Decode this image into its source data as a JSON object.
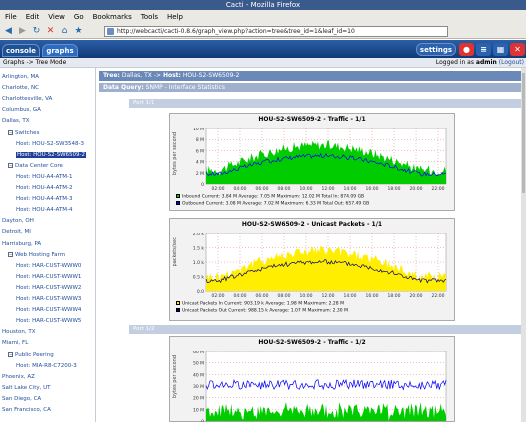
{
  "window": {
    "title": "Cacti - Mozilla Firefox"
  },
  "menu": [
    {
      "label": "File"
    },
    {
      "label": "Edit"
    },
    {
      "label": "View"
    },
    {
      "label": "Go"
    },
    {
      "label": "Bookmarks"
    },
    {
      "label": "Tools"
    },
    {
      "label": "Help"
    }
  ],
  "address": {
    "url": "http://webcacti/cacti-0.8.6/graph_view.php?action=tree&tree_id=1&leaf_id=10"
  },
  "tabs": {
    "console": "console",
    "graphs": "graphs",
    "settings": "settings"
  },
  "breadcrumb": {
    "text": "Graphs -> Tree Mode",
    "logged_prefix": "Logged in as ",
    "user": "admin",
    "logout": "(Logout)"
  },
  "sidebar": {
    "items": [
      {
        "label": "Arlington, MA",
        "level": 0
      },
      {
        "label": "Charlotte, NC",
        "level": 0
      },
      {
        "label": "Charlottesville, VA",
        "level": 0
      },
      {
        "label": "Columbus, GA",
        "level": 0
      },
      {
        "label": "Dallas, TX",
        "level": 0
      },
      {
        "label": "Switches",
        "level": 1,
        "icon": "folder"
      },
      {
        "label": "Host: HOU-S2-SW3548-3",
        "level": 2
      },
      {
        "label": "Host: HOU-S2-SW6509-2",
        "level": 2,
        "selected": true
      },
      {
        "label": "Data Center Core",
        "level": 1,
        "icon": "folder"
      },
      {
        "label": "Host: HOU-A4-ATM-1",
        "level": 2
      },
      {
        "label": "Host: HOU-A4-ATM-2",
        "level": 2
      },
      {
        "label": "Host: HOU-A4-ATM-3",
        "level": 2
      },
      {
        "label": "Host: HOU-A4-ATM-4",
        "level": 2
      },
      {
        "label": "Dayton, OH",
        "level": 0
      },
      {
        "label": "Detroit, MI",
        "level": 0
      },
      {
        "label": "Harrisburg, PA",
        "level": 0
      },
      {
        "label": "Web Hosting Farm",
        "level": 1,
        "icon": "folder"
      },
      {
        "label": "Host: HAR-CUST-WWW0",
        "level": 2
      },
      {
        "label": "Host: HAR-CUST-WWW1",
        "level": 2
      },
      {
        "label": "Host: HAR-CUST-WWW2",
        "level": 2
      },
      {
        "label": "Host: HAR-CUST-WWW3",
        "level": 2
      },
      {
        "label": "Host: HAR-CUST-WWW4",
        "level": 2
      },
      {
        "label": "Host: HAR-CUST-WWW5",
        "level": 2
      },
      {
        "label": "Houston, TX",
        "level": 0
      },
      {
        "label": "Miami, FL",
        "level": 0
      },
      {
        "label": "Public Peering",
        "level": 1,
        "icon": "folder"
      },
      {
        "label": "Host: MIA-R8-C7200-3",
        "level": 2
      },
      {
        "label": "Phoenix, AZ",
        "level": 0
      },
      {
        "label": "Salt Lake City, UT",
        "level": 0
      },
      {
        "label": "San Diego, CA",
        "level": 0
      },
      {
        "label": "San Francisco, CA",
        "level": 0
      }
    ]
  },
  "main": {
    "tree_header": {
      "tree_label": "Tree:",
      "tree": "Dallas, TX",
      "sep": "->",
      "host_label": "Host:",
      "host": "HOU-S2-SW6509-2"
    },
    "data_query": {
      "label": "Data Query:",
      "value": "SNMP - Interface Statistics"
    },
    "ports": [
      {
        "label": "Port 1/1"
      },
      {
        "label": "Port 1/2"
      }
    ],
    "graphs": [
      {
        "title": "HOU-S2-SW6509-2 - Traffic - 1/1",
        "ylabel": "bytes per second",
        "yticks": [
          "10 M",
          "8 M",
          "6 M",
          "4 M",
          "2 M",
          "0"
        ],
        "xticks": [
          "02:00",
          "04:00",
          "06:00",
          "08:00",
          "10:00",
          "12:00",
          "14:00",
          "16:00",
          "18:00",
          "20:00",
          "22:00"
        ],
        "legend": [
          "Inbound   Current:   3.84 M   Average:   7.05 M   Maximum:  12.02 M   Total In:  874.09 GB",
          "Outbound  Current:   3.08 M   Average:   7.02 M   Maximum:   6.33 M   Total Out: 657.49 GB"
        ],
        "colors": [
          "#00cc00",
          "#0000ff"
        ]
      },
      {
        "title": "HOU-S2-SW6509-2 - Unicast Packets - 1/1",
        "ylabel": "packets/sec",
        "yticks": [
          "2.0 k",
          "1.5 k",
          "1.0 k",
          "0.5 k",
          "0.0"
        ],
        "xticks": [
          "02:00",
          "04:00",
          "06:00",
          "08:00",
          "10:00",
          "12:00",
          "14:00",
          "16:00",
          "18:00",
          "20:00",
          "22:00"
        ],
        "legend": [
          "Unicast Packets In   Current:  903.19 k   Average:   1.98 M   Maximum:   2.28 M",
          "Unicast Packets Out  Current:  988.15 k   Average:   1.07 M   Maximum:   2.30 M"
        ],
        "colors": [
          "#ffee00",
          "#000066"
        ]
      },
      {
        "title": "HOU-S2-SW6509-2 - Traffic - 1/2",
        "ylabel": "bytes per second",
        "yticks": [
          "60 M",
          "50 M",
          "40 M",
          "30 M",
          "20 M",
          "10 M",
          "0"
        ],
        "xticks": [],
        "legend": [],
        "colors": [
          "#00cc00",
          "#0000ff"
        ]
      }
    ]
  }
}
